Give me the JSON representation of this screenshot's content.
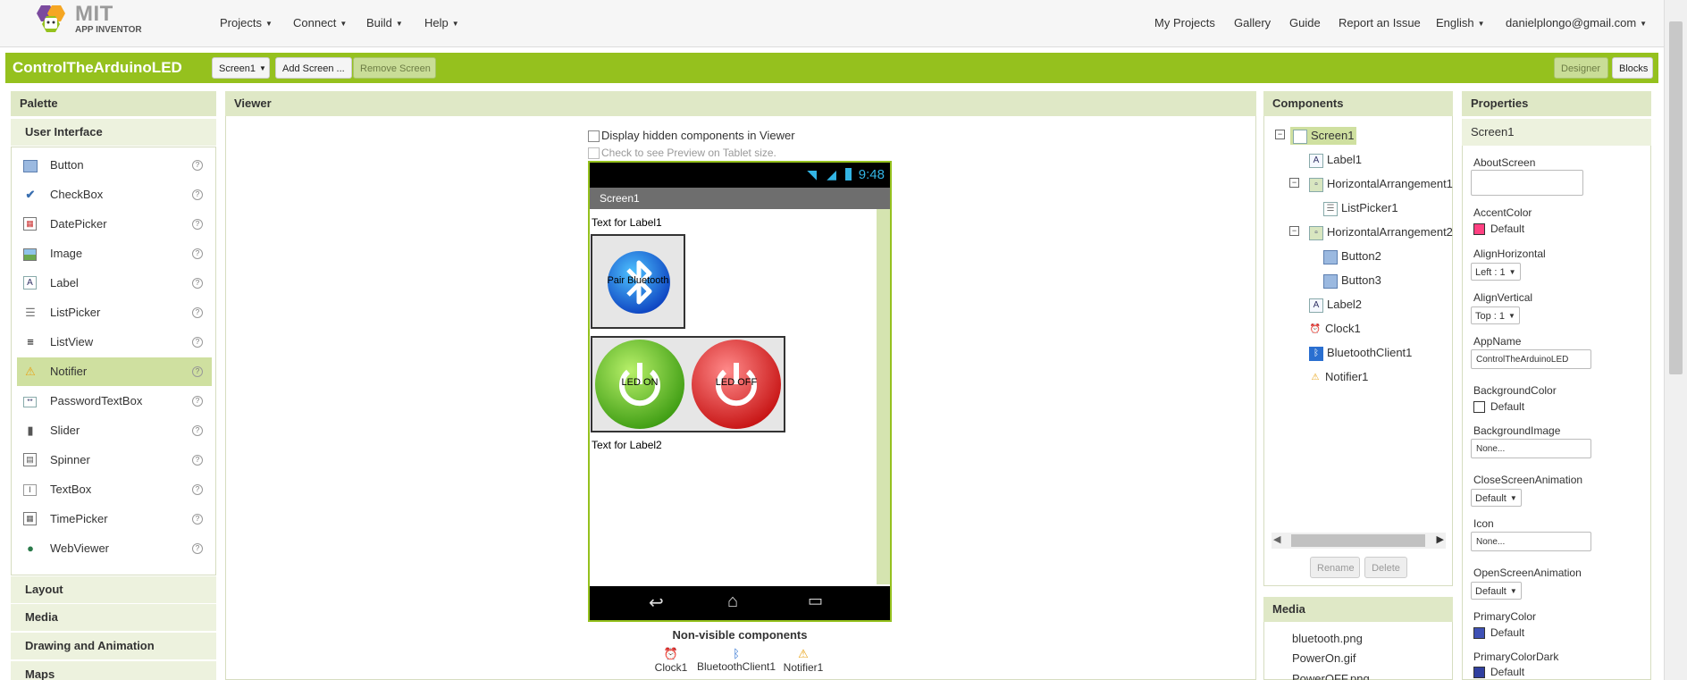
{
  "logo": {
    "mit": "MIT",
    "appinventor": "APP INVENTOR"
  },
  "topnav": {
    "left": [
      "Projects",
      "Connect",
      "Build",
      "Help"
    ],
    "right": {
      "my_projects": "My Projects",
      "gallery": "Gallery",
      "guide": "Guide",
      "report": "Report an Issue",
      "language": "English",
      "account": "danielplongo@gmail.com"
    }
  },
  "toolbar": {
    "project_name": "ControlTheArduinoLED",
    "screen_select": "Screen1",
    "add_screen": "Add Screen ...",
    "remove_screen": "Remove Screen",
    "designer": "Designer",
    "blocks": "Blocks"
  },
  "palette": {
    "title": "Palette",
    "category_open": "User Interface",
    "items": [
      {
        "label": "Button",
        "icon": "button-icon"
      },
      {
        "label": "CheckBox",
        "icon": "checkbox-icon"
      },
      {
        "label": "DatePicker",
        "icon": "datepicker-icon"
      },
      {
        "label": "Image",
        "icon": "image-icon"
      },
      {
        "label": "Label",
        "icon": "label-icon"
      },
      {
        "label": "ListPicker",
        "icon": "listpicker-icon"
      },
      {
        "label": "ListView",
        "icon": "listview-icon"
      },
      {
        "label": "Notifier",
        "icon": "notifier-icon"
      },
      {
        "label": "PasswordTextBox",
        "icon": "passwordtextbox-icon"
      },
      {
        "label": "Slider",
        "icon": "slider-icon"
      },
      {
        "label": "Spinner",
        "icon": "spinner-icon"
      },
      {
        "label": "TextBox",
        "icon": "textbox-icon"
      },
      {
        "label": "TimePicker",
        "icon": "timepicker-icon"
      },
      {
        "label": "WebViewer",
        "icon": "webviewer-icon"
      }
    ],
    "selected_index": 7,
    "categories": [
      "Layout",
      "Media",
      "Drawing and Animation",
      "Maps"
    ]
  },
  "viewer": {
    "title": "Viewer",
    "hidden_checkbox": "Display hidden components in Viewer",
    "tablet_checkbox": "Check to see Preview on Tablet size.",
    "status_time": "9:48",
    "screen_title": "Screen1",
    "label1": "Text for Label1",
    "bt_button": "Pair Bluetooth",
    "led_on": "LED ON",
    "led_off": "LED OFF",
    "label2": "Text for Label2",
    "nonvisible_title": "Non-visible components",
    "nonvisible": [
      "Clock1",
      "BluetoothClient1",
      "Notifier1"
    ]
  },
  "components": {
    "title": "Components",
    "tree": [
      "Screen1",
      "Label1",
      "HorizontalArrangement1",
      "ListPicker1",
      "HorizontalArrangement2",
      "Button2",
      "Button3",
      "Label2",
      "Clock1",
      "BluetoothClient1",
      "Notifier1"
    ],
    "rename": "Rename",
    "delete": "Delete"
  },
  "media": {
    "title": "Media",
    "files": [
      "bluetooth.png",
      "PowerOn.gif",
      "PowerOFF.png"
    ]
  },
  "properties": {
    "title": "Properties",
    "component": "Screen1",
    "about_screen": {
      "label": "AboutScreen"
    },
    "accent_color": {
      "label": "AccentColor",
      "value": "Default",
      "color": "#ff4081"
    },
    "align_horizontal": {
      "label": "AlignHorizontal",
      "value": "Left : 1"
    },
    "align_vertical": {
      "label": "AlignVertical",
      "value": "Top : 1"
    },
    "app_name": {
      "label": "AppName",
      "value": "ControlTheArduinoLED"
    },
    "background_color": {
      "label": "BackgroundColor",
      "value": "Default",
      "color": "#ffffff"
    },
    "background_image": {
      "label": "BackgroundImage",
      "value": "None..."
    },
    "close_screen_animation": {
      "label": "CloseScreenAnimation",
      "value": "Default"
    },
    "icon": {
      "label": "Icon",
      "value": "None..."
    },
    "open_screen_animation": {
      "label": "OpenScreenAnimation",
      "value": "Default"
    },
    "primary_color": {
      "label": "PrimaryColor",
      "value": "Default",
      "color": "#3f51b5"
    },
    "primary_color_dark": {
      "label": "PrimaryColorDark",
      "value": "Default",
      "color": "#303f9f"
    }
  },
  "colors": {
    "accent": "#95c11e",
    "panel_header": "#dfe8c6"
  }
}
